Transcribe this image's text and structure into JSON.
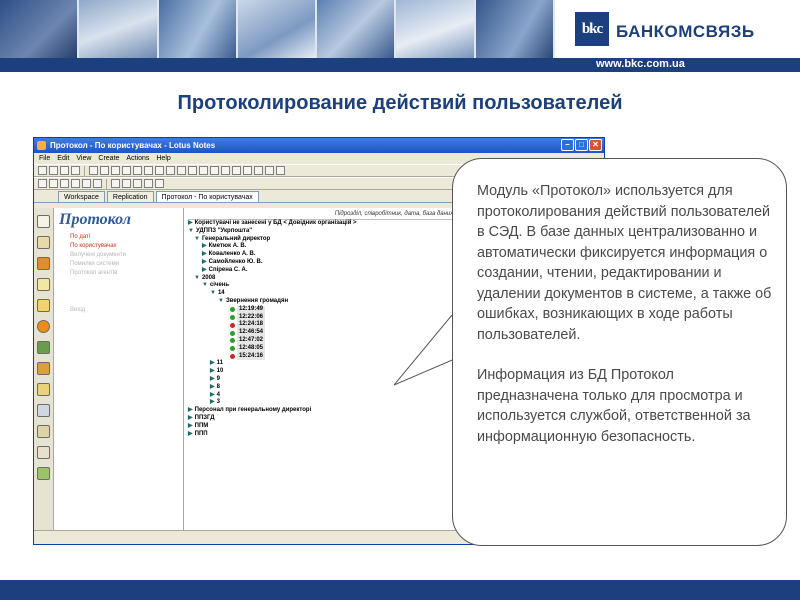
{
  "header": {
    "brand_mark": "bkc",
    "brand_name": "БАНКОМСВЯЗЬ",
    "site_url": "www.bkc.com.ua"
  },
  "slide_title": "Протоколирование действий пользователей",
  "window": {
    "title": "Протокол - По користувачах - Lotus Notes",
    "menu": [
      "File",
      "Edit",
      "View",
      "Create",
      "Actions",
      "Help"
    ],
    "tabs": [
      "Workspace",
      "Replication",
      "Протокол - По користувачах"
    ],
    "nav": {
      "title": "Протокол",
      "items": [
        "По даті",
        "По користувачах",
        "Вилучені документи",
        "Помилки системи",
        "Протокол агентів"
      ],
      "extra": "Вихід"
    },
    "view": {
      "column_header": "Підрозділ, співробітник, дата, база даних",
      "rows": [
        {
          "level": 0,
          "text": "Користувачі не занесені у БД < Довідник організацій >"
        },
        {
          "level": 0,
          "text": "УДППЗ \"Укрпошта\""
        },
        {
          "level": 1,
          "text": "Генеральний директор"
        },
        {
          "level": 2,
          "text": "Кметюк А. В."
        },
        {
          "level": 2,
          "text": "Коваленко А. В."
        },
        {
          "level": 2,
          "text": "Самойленко Ю. В."
        },
        {
          "level": 2,
          "text": "Спірена С. А."
        },
        {
          "level": 1,
          "text": "2008"
        },
        {
          "level": 2,
          "text": "січень"
        },
        {
          "level": 3,
          "text": "14"
        },
        {
          "level": 4,
          "text": "Звернення громадян"
        },
        {
          "level": 5,
          "text": "12:19:49",
          "status": "green"
        },
        {
          "level": 5,
          "text": "12:22:06",
          "status": "green"
        },
        {
          "level": 5,
          "text": "12:24:18",
          "status": "red"
        },
        {
          "level": 5,
          "text": "12:46:54",
          "status": "green"
        },
        {
          "level": 5,
          "text": "12:47:02",
          "status": "green"
        },
        {
          "level": 5,
          "text": "12:48:05",
          "status": "green"
        },
        {
          "level": 5,
          "text": "15:24:16",
          "status": "red"
        },
        {
          "level": 3,
          "text": "11"
        },
        {
          "level": 3,
          "text": "10"
        },
        {
          "level": 3,
          "text": "9"
        },
        {
          "level": 3,
          "text": "8"
        },
        {
          "level": 3,
          "text": "4"
        },
        {
          "level": 3,
          "text": "3"
        },
        {
          "level": 0,
          "text": "Персонал при генеральному директорі"
        },
        {
          "level": 0,
          "text": "ППЗГД"
        },
        {
          "level": 0,
          "text": "ППМ"
        },
        {
          "level": 0,
          "text": "ППП"
        }
      ]
    }
  },
  "callout": {
    "paragraph1": "Модуль «Протокол» используется для протоколирования действий пользователей в СЭД. В базе данных централизованно и автоматически фиксируется информация о создании, чтении, редактировании и удалении документов в системе, а также об ошибках, возникающих в ходе работы пользователей.",
    "paragraph2": "Информация из БД Протокол предназначена только для просмотра и используется службой, ответственной за информационную безопасность."
  }
}
